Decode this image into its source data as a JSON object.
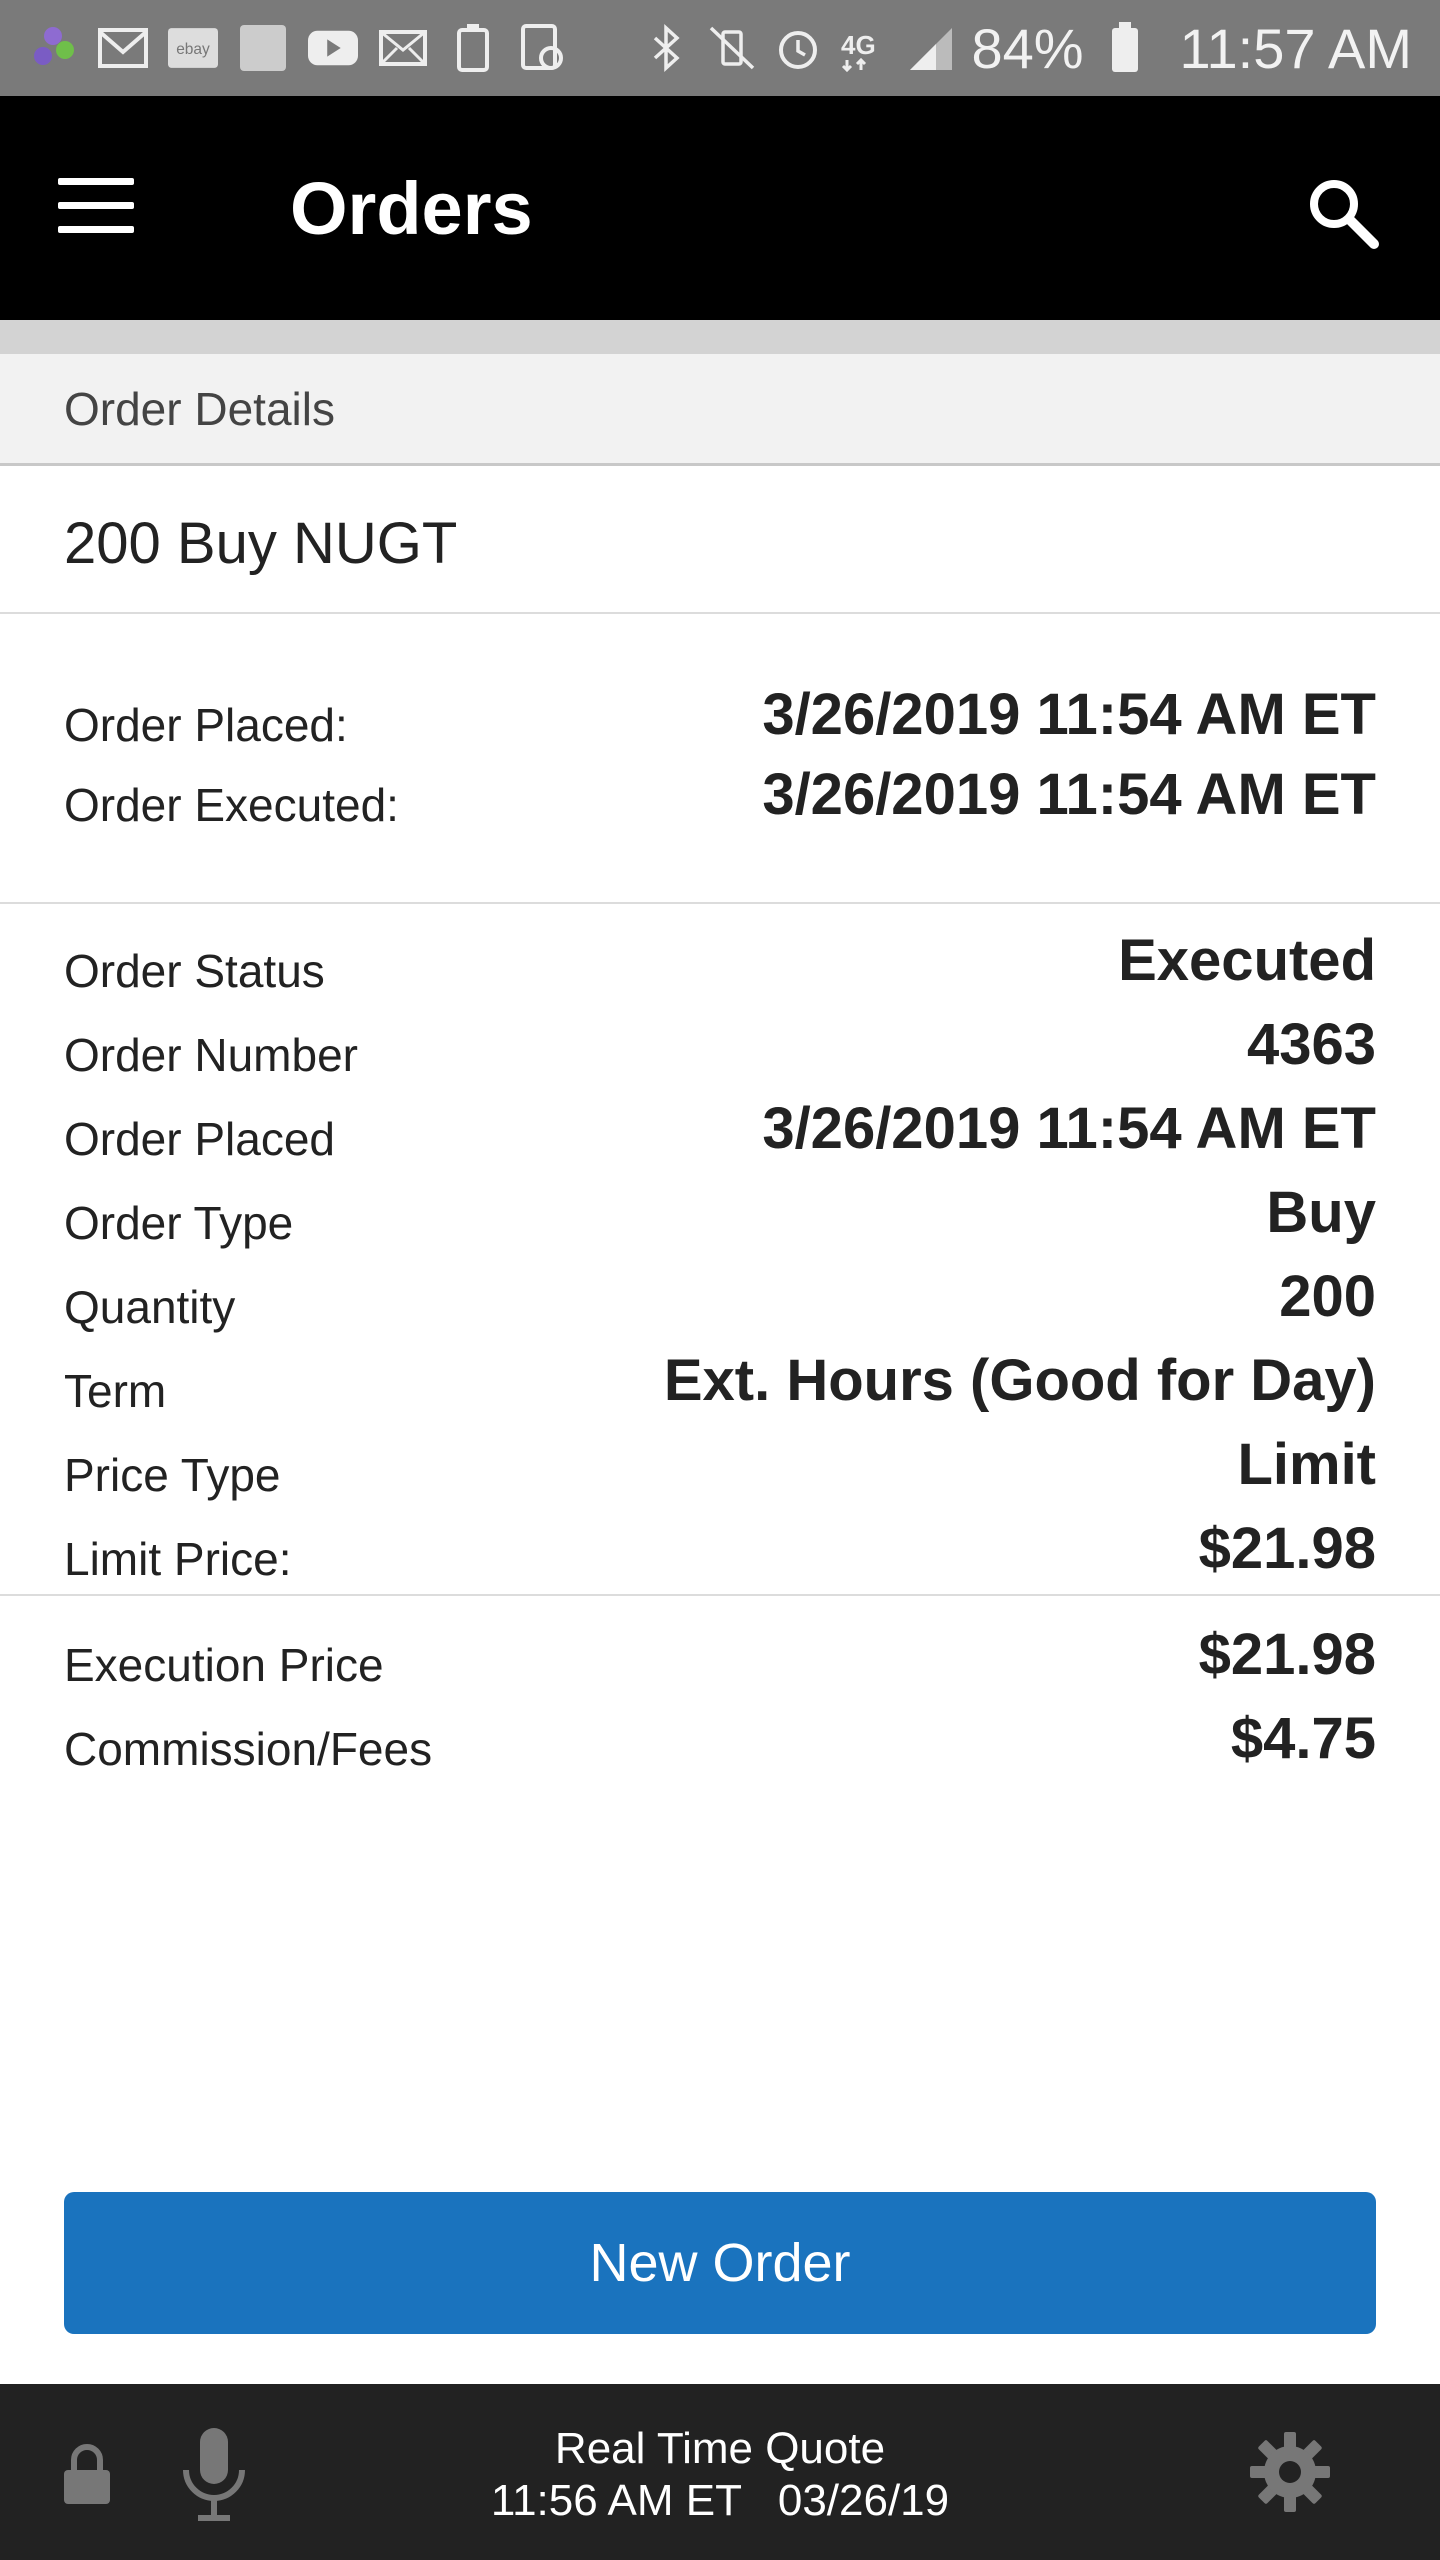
{
  "status_bar": {
    "battery_percent": "84%",
    "time": "11:57 AM",
    "notification_icons": [
      "pinwheel-icon",
      "gmail-icon",
      "ebay-icon",
      "bible-icon",
      "youtube-icon",
      "mail-icon",
      "battery-saver-icon",
      "screenshot-icon"
    ],
    "system_icons": [
      "bluetooth-icon",
      "vibrate-mute-icon",
      "alarm-icon",
      "4g-lte-icon",
      "signal-icon",
      "battery-icon"
    ]
  },
  "app_bar": {
    "title": "Orders"
  },
  "section_header": "Order Details",
  "order": {
    "headline": "200 Buy NUGT",
    "timeline": [
      {
        "label": "Order Placed:",
        "value": "3/26/2019 11:54 AM ET"
      },
      {
        "label": "Order Executed:",
        "value": "3/26/2019 11:54 AM ET"
      }
    ],
    "details": [
      {
        "label": "Order Status",
        "value": "Executed"
      },
      {
        "label": "Order Number",
        "value": "4363"
      },
      {
        "label": "Order Placed",
        "value": "3/26/2019 11:54 AM ET"
      },
      {
        "label": "Order Type",
        "value": "Buy"
      },
      {
        "label": "Quantity",
        "value": "200"
      },
      {
        "label": "Term",
        "value": "Ext. Hours (Good for Day)"
      },
      {
        "label": "Price Type",
        "value": "Limit"
      },
      {
        "label": "Limit Price:",
        "value": "$21.98"
      }
    ],
    "execution": [
      {
        "label": "Execution Price",
        "value": "$21.98"
      },
      {
        "label": "Commission/Fees",
        "value": "$4.75"
      }
    ]
  },
  "new_order_button": "New Order",
  "bottom_bar": {
    "quote_title": "Real Time Quote",
    "quote_time": "11:56 AM ET   03/26/19"
  },
  "colors": {
    "status_bar": "#7a7a7a",
    "app_bar": "#000000",
    "button": "#1a73be",
    "bottom_bar": "#222222"
  }
}
